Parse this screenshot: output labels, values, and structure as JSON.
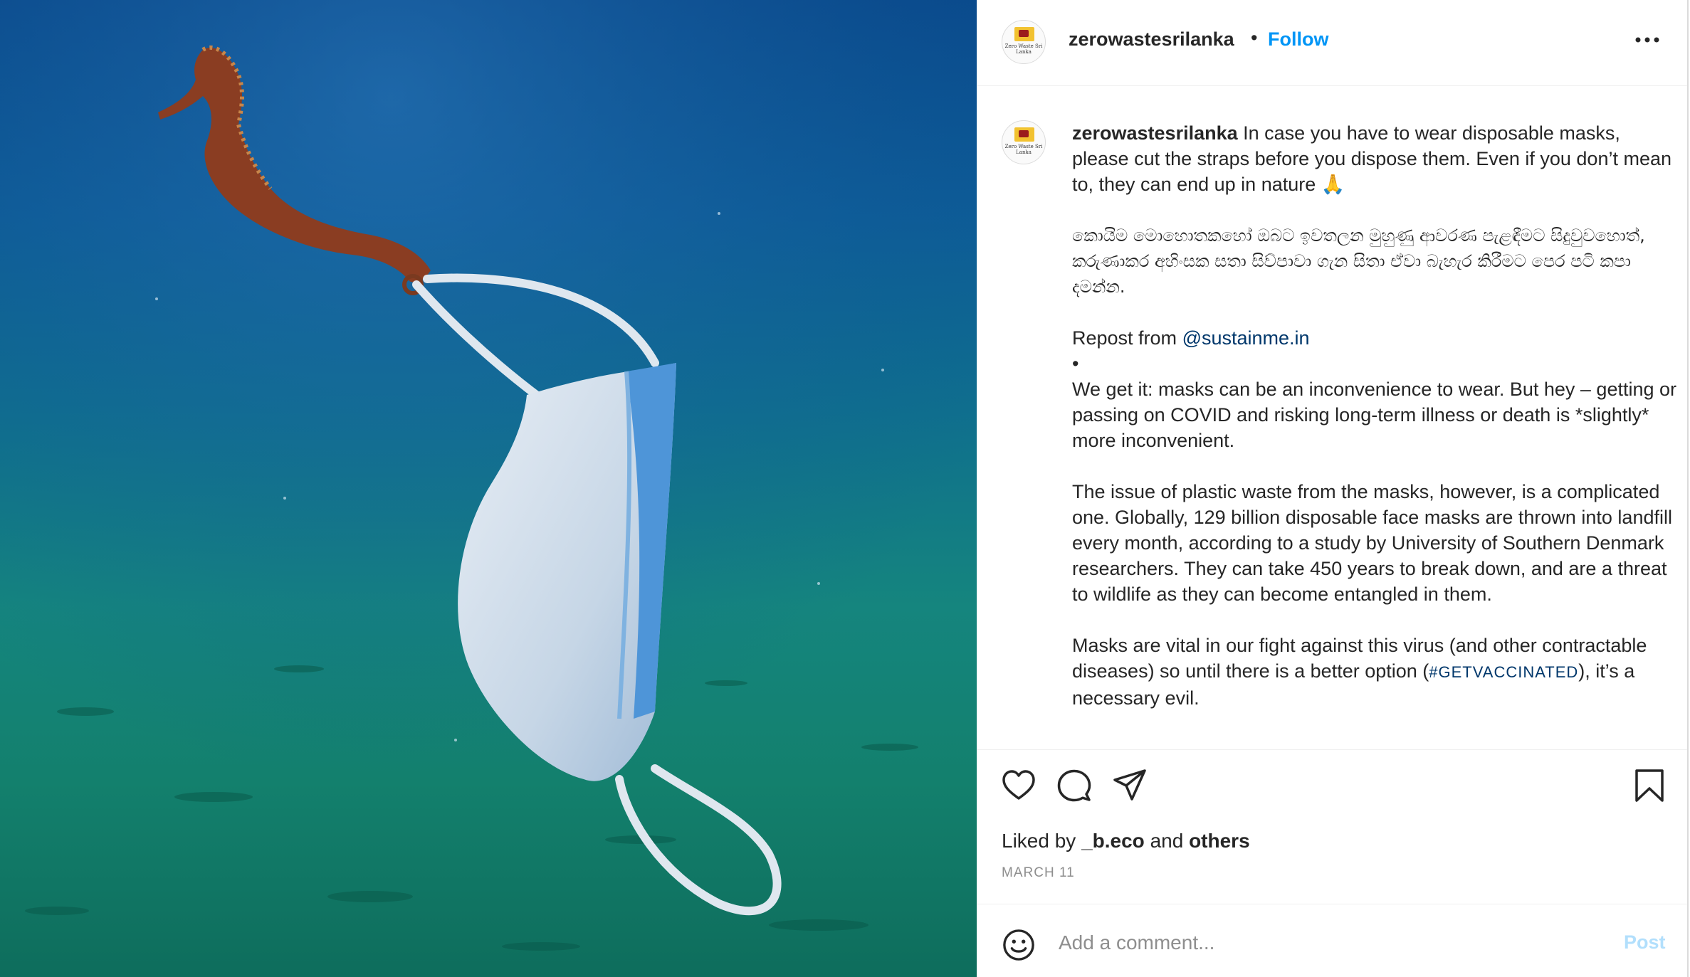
{
  "post": {
    "username": "zerowastesrilanka",
    "separator": "•",
    "follow_label": "Follow",
    "avatar_logo_text": "Zero Waste Sri Lanka",
    "more_icon": "more-horizontal-icon"
  },
  "caption": {
    "username": "zerowastesrilanka",
    "intro": "In case you have to wear disposable masks, please cut the straps before you dispose them. Even if you don’t mean to, they can end up in nature 🙏",
    "sinhala": "කොයිම මොහොතකහෝ ඔබට ඉවතලන මුහුණු ආවරණ පැළඳීමට සිදුවුවහොත්, කරුණාකර අහිංසක සතා සිව්පාවා ගැන සිතා ඒවා බැහැර කිරීමට පෙර පටි කපා දමන්න.",
    "repost_prefix": "Repost from",
    "repost_handle": "@sustainme.in",
    "bullet": "•",
    "para1": "We get it: masks can be an inconvenience to wear. But hey – getting or passing on COVID and risking long-term illness or death is *slightly* more inconvenient.",
    "para2": "The issue of plastic waste from the masks, however, is a complicated one. Globally, 129 billion disposable face masks are thrown into landfill every month, according to a study by University of Southern Denmark researchers. They can take 450 years to break down, and are a threat to wildlife as they can become entangled in them.",
    "para3_a": "Masks are vital in our fight against this virus (and other contractable diseases) so until there is a better option (",
    "para3_tag": "#GETVACCINATED",
    "para3_b": "), it’s a necessary evil."
  },
  "actions": {
    "like_icon": "heart-icon",
    "comment_icon": "comment-icon",
    "share_icon": "send-icon",
    "save_icon": "bookmark-icon"
  },
  "likes": {
    "prefix": "Liked by",
    "user": "_b.eco",
    "conj": "and",
    "others": "others"
  },
  "date": "MARCH 11",
  "comment": {
    "placeholder": "Add a comment...",
    "post_label": "Post",
    "emoji_icon": "emoji-smile-icon"
  },
  "colors": {
    "link_blue": "#0095f6",
    "mention_blue": "#00376b",
    "post_disabled": "#b2dffc",
    "muted_gray": "#8e8e8e"
  }
}
